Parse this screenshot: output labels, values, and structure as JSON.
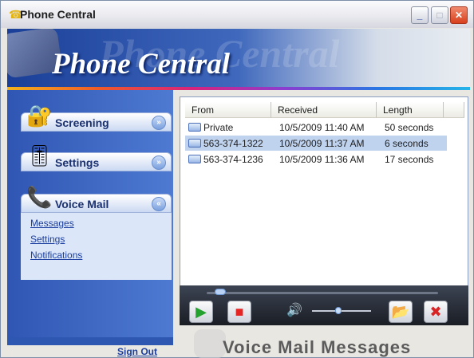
{
  "window": {
    "title": "Phone Central",
    "icon": "phone-icon",
    "buttons": {
      "minimize": "_",
      "maximize": "□",
      "close": "✕"
    }
  },
  "banner": {
    "title": "Phone Central"
  },
  "sidebar": {
    "sections": [
      {
        "label": "Screening",
        "icon": "screening-icon",
        "chevron": "»"
      },
      {
        "label": "Settings",
        "icon": "settings-icon",
        "chevron": "»"
      },
      {
        "label": "Voice Mail",
        "icon": "voicemail-icon",
        "chevron": "«",
        "links": [
          "Messages",
          "Settings",
          "Notifications"
        ]
      }
    ],
    "sign_out": "Sign Out"
  },
  "table": {
    "columns": [
      "From",
      "Received",
      "Length"
    ],
    "rows": [
      {
        "from": "Private",
        "received": "10/5/2009 11:40 AM",
        "length": "50 seconds",
        "selected": false
      },
      {
        "from": "563-374-1322",
        "received": "10/5/2009 11:37 AM",
        "length": "6 seconds",
        "selected": true
      },
      {
        "from": "563-374-1236",
        "received": "10/5/2009 11:36 AM",
        "length": "17 seconds",
        "selected": false
      }
    ]
  },
  "player": {
    "play_icon": "▶",
    "stop_icon": "■",
    "volume_icon": "🔊",
    "open_icon": "📂",
    "delete_icon": "✖",
    "progress": 0.04,
    "volume": 0.45
  },
  "footer": {
    "title": "Voice Mail Messages"
  }
}
